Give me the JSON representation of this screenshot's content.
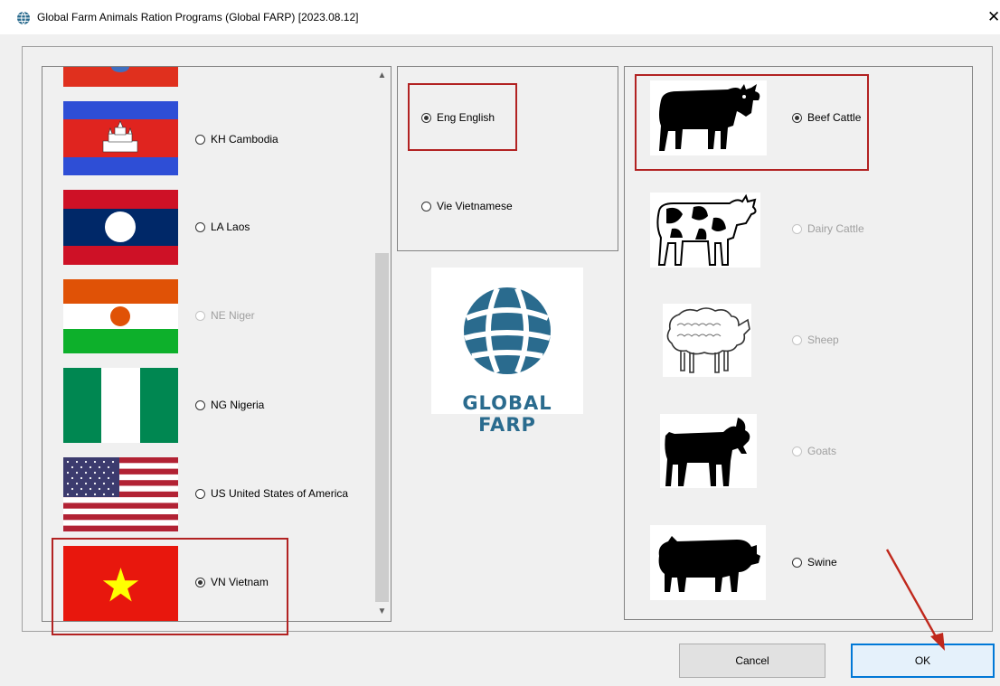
{
  "window": {
    "title": "Global Farm Animals Ration Programs (Global FARP) [2023.08.12]",
    "close_glyph": "✕"
  },
  "countries": [
    {
      "code": "KH",
      "label": "KH Cambodia",
      "checked": false,
      "enabled": true
    },
    {
      "code": "LA",
      "label": "LA Laos",
      "checked": false,
      "enabled": true
    },
    {
      "code": "NE",
      "label": "NE Niger",
      "checked": false,
      "enabled": false
    },
    {
      "code": "NG",
      "label": "NG Nigeria",
      "checked": false,
      "enabled": true
    },
    {
      "code": "US",
      "label": "US United States of America",
      "checked": false,
      "enabled": true
    },
    {
      "code": "VN",
      "label": "VN Vietnam",
      "checked": true,
      "enabled": true
    }
  ],
  "languages": [
    {
      "label": "Eng English",
      "checked": true
    },
    {
      "label": "Vie Vietnamese",
      "checked": false
    }
  ],
  "logo": {
    "text": "GLOBAL FARP"
  },
  "animals": [
    {
      "label": "Beef Cattle",
      "checked": true,
      "enabled": true
    },
    {
      "label": "Dairy Cattle",
      "checked": false,
      "enabled": false
    },
    {
      "label": "Sheep",
      "checked": false,
      "enabled": false
    },
    {
      "label": "Goats",
      "checked": false,
      "enabled": false
    },
    {
      "label": "Swine",
      "checked": false,
      "enabled": true
    }
  ],
  "buttons": {
    "cancel": "Cancel",
    "ok": "OK"
  },
  "colors": {
    "highlight": "#b22222",
    "ok_border": "#0078d7",
    "logo": "#2a6b8e"
  }
}
